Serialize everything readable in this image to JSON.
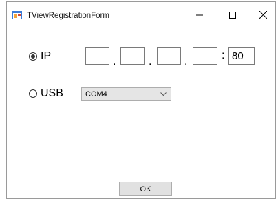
{
  "window": {
    "title": "TViewRegistrationForm",
    "icon": "form-app-icon",
    "controls": {
      "minimize": "minimize-icon",
      "maximize": "maximize-icon",
      "close": "close-icon"
    }
  },
  "connection": {
    "ip": {
      "label": "IP",
      "selected": true,
      "octets": [
        "",
        "",
        "",
        ""
      ],
      "separator": ".",
      "port_separator": ":",
      "port": "80"
    },
    "usb": {
      "label": "USB",
      "selected": false,
      "port_value": "COM4"
    }
  },
  "actions": {
    "ok_label": "OK"
  }
}
